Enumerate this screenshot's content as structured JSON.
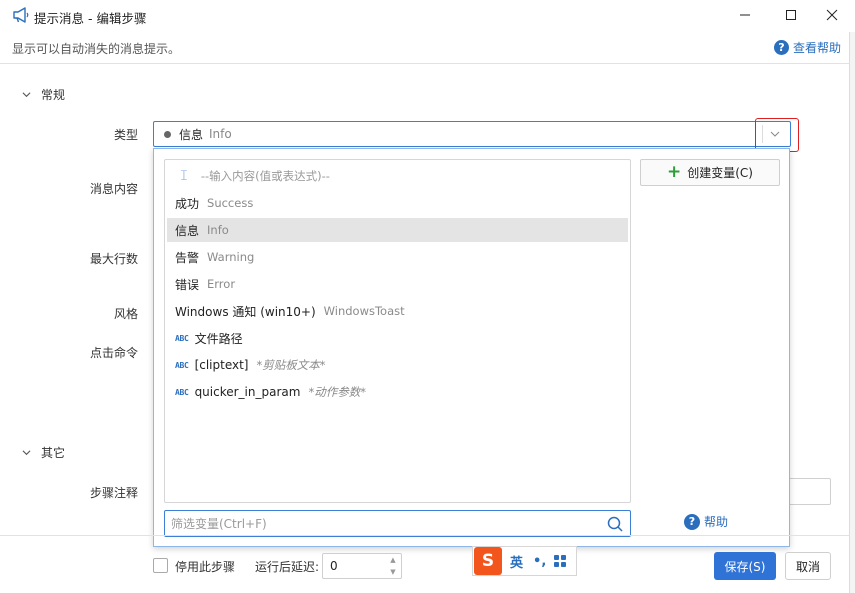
{
  "window": {
    "title": "提示消息 - 编辑步骤",
    "subtitle": "显示可以自动消失的消息提示。",
    "help_label": "查看帮助"
  },
  "sections": {
    "general": "常规",
    "other": "其它"
  },
  "fields": {
    "type_label": "类型",
    "message_label": "消息内容",
    "max_lines_label": "最大行数",
    "style_label": "风格",
    "click_command_label": "点击命令",
    "step_note_label": "步骤注释"
  },
  "type_combo": {
    "value": "信息",
    "value_sub": "Info"
  },
  "dropdown": {
    "placeholder_item": "--输入内容(值或表达式)--",
    "items": [
      {
        "label": "成功",
        "sub": "Success"
      },
      {
        "label": "信息",
        "sub": "Info"
      },
      {
        "label": "告警",
        "sub": "Warning"
      },
      {
        "label": "错误",
        "sub": "Error"
      },
      {
        "label": "Windows 通知 (win10+)",
        "sub": "WindowsToast"
      }
    ],
    "variables": [
      {
        "badge": "ABC",
        "label": "文件路径",
        "sub": ""
      },
      {
        "badge": "ABC",
        "label": "[cliptext]",
        "sub": "*剪贴板文本*"
      },
      {
        "badge": "ABC",
        "label": "quicker_in_param",
        "sub": "*动作参数*"
      }
    ],
    "create_var_label": "创建变量(C)",
    "filter_placeholder": "筛选变量(Ctrl+F)",
    "help_label": "帮助"
  },
  "footer": {
    "disable_step_label": "停用此步骤",
    "delay_label": "运行后延迟:",
    "delay_value": "0",
    "save_label": "保存(S)",
    "cancel_label": "取消"
  },
  "ime": {
    "logo": "S",
    "lang": "英",
    "punct": "•,"
  },
  "colors": {
    "accent": "#2f73d6",
    "highlight_border": "#e02020",
    "ime_brand": "#f2561d"
  }
}
